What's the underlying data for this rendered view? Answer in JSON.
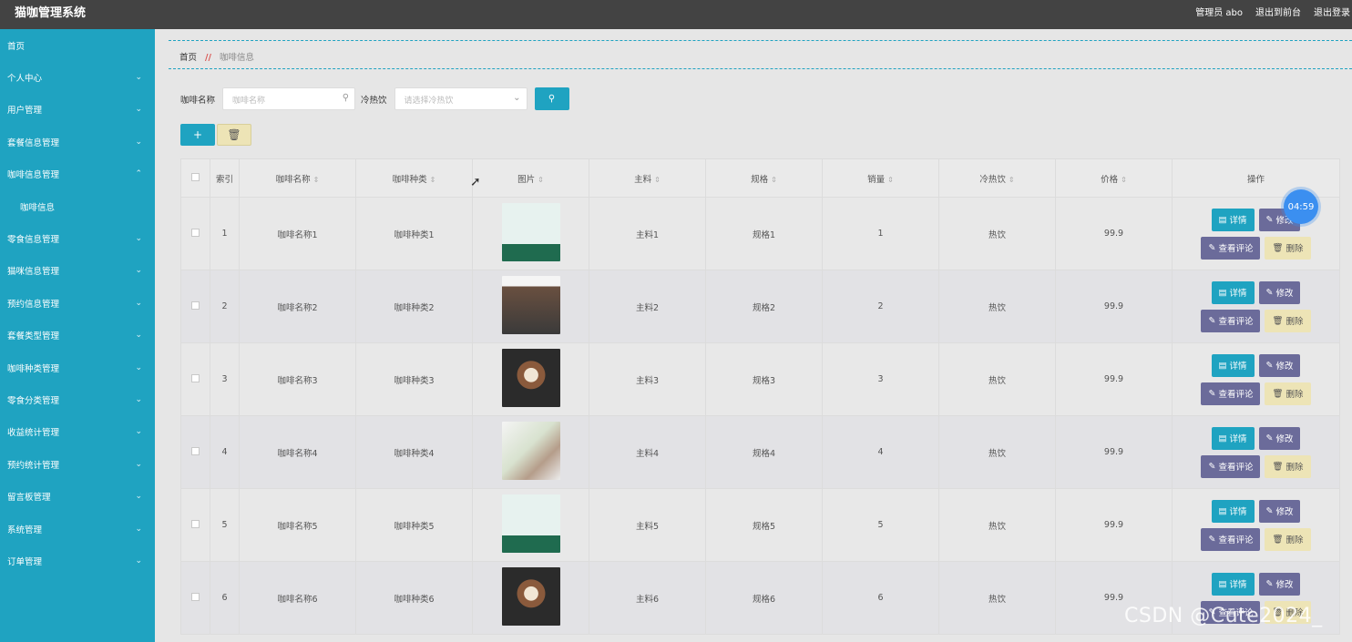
{
  "app": {
    "title": "猫咖管理系统"
  },
  "header": {
    "admin": "管理员 abo",
    "front": "退出到前台",
    "logout": "退出登录"
  },
  "sidebar": {
    "items": [
      {
        "label": "首页",
        "chevron": ""
      },
      {
        "label": "个人中心",
        "chevron": "⌄"
      },
      {
        "label": "用户管理",
        "chevron": "⌄"
      },
      {
        "label": "套餐信息管理",
        "chevron": "⌄"
      },
      {
        "label": "咖啡信息管理",
        "chevron": "⌃"
      },
      {
        "label": "咖啡信息",
        "chevron": "",
        "sub": true
      },
      {
        "label": "零食信息管理",
        "chevron": "⌄"
      },
      {
        "label": "猫咪信息管理",
        "chevron": "⌄"
      },
      {
        "label": "预约信息管理",
        "chevron": "⌄"
      },
      {
        "label": "套餐类型管理",
        "chevron": "⌄"
      },
      {
        "label": "咖啡种类管理",
        "chevron": "⌄"
      },
      {
        "label": "零食分类管理",
        "chevron": "⌄"
      },
      {
        "label": "收益统计管理",
        "chevron": "⌄"
      },
      {
        "label": "预约统计管理",
        "chevron": "⌄"
      },
      {
        "label": "留言板管理",
        "chevron": "⌄"
      },
      {
        "label": "系统管理",
        "chevron": "⌄"
      },
      {
        "label": "订单管理",
        "chevron": "⌄"
      }
    ]
  },
  "breadcrumb": {
    "home": "首页",
    "sep": "//",
    "current": "咖啡信息"
  },
  "search": {
    "name_label": "咖啡名称",
    "name_placeholder": "咖啡名称",
    "temp_label": "冷热饮",
    "temp_placeholder": "请选择冷热饮"
  },
  "table": {
    "headers": {
      "index": "索引",
      "name": "咖啡名称",
      "kind": "咖啡种类",
      "image": "图片",
      "main": "主料",
      "spec": "规格",
      "sales": "销量",
      "temp": "冷热饮",
      "price": "价格",
      "ops": "操作"
    },
    "rows": [
      {
        "index": "1",
        "name": "咖啡名称1",
        "kind": "咖啡种类1",
        "main": "主料1",
        "spec": "规格1",
        "sales": "1",
        "temp": "热饮",
        "price": "99.9",
        "img": "promo"
      },
      {
        "index": "2",
        "name": "咖啡名称2",
        "kind": "咖啡种类2",
        "main": "主料2",
        "spec": "规格2",
        "sales": "2",
        "temp": "热饮",
        "price": "99.9",
        "img": "cup"
      },
      {
        "index": "3",
        "name": "咖啡名称3",
        "kind": "咖啡种类3",
        "main": "主料3",
        "spec": "规格3",
        "sales": "3",
        "temp": "热饮",
        "price": "99.9",
        "img": "latte"
      },
      {
        "index": "4",
        "name": "咖啡名称4",
        "kind": "咖啡种类4",
        "main": "主料4",
        "spec": "规格4",
        "sales": "4",
        "temp": "热饮",
        "price": "99.9",
        "img": "flower"
      },
      {
        "index": "5",
        "name": "咖啡名称5",
        "kind": "咖啡种类5",
        "main": "主料5",
        "spec": "规格5",
        "sales": "5",
        "temp": "热饮",
        "price": "99.9",
        "img": "promo"
      },
      {
        "index": "6",
        "name": "咖啡名称6",
        "kind": "咖啡种类6",
        "main": "主料6",
        "spec": "规格6",
        "sales": "6",
        "temp": "热饮",
        "price": "99.9",
        "img": "latte"
      }
    ],
    "buttons": {
      "detail": "详情",
      "edit": "修改",
      "review": "查看评论",
      "remove": "删除"
    }
  },
  "overlay": {
    "timer": "04:59",
    "watermark": "CSDN @Cute2024_"
  },
  "colors": {
    "sidebar": "#1fa3c1",
    "topbar": "#434343",
    "accent": "#1fa3c1",
    "edit": "#6b6b9a",
    "remove": "#ede4b6"
  }
}
